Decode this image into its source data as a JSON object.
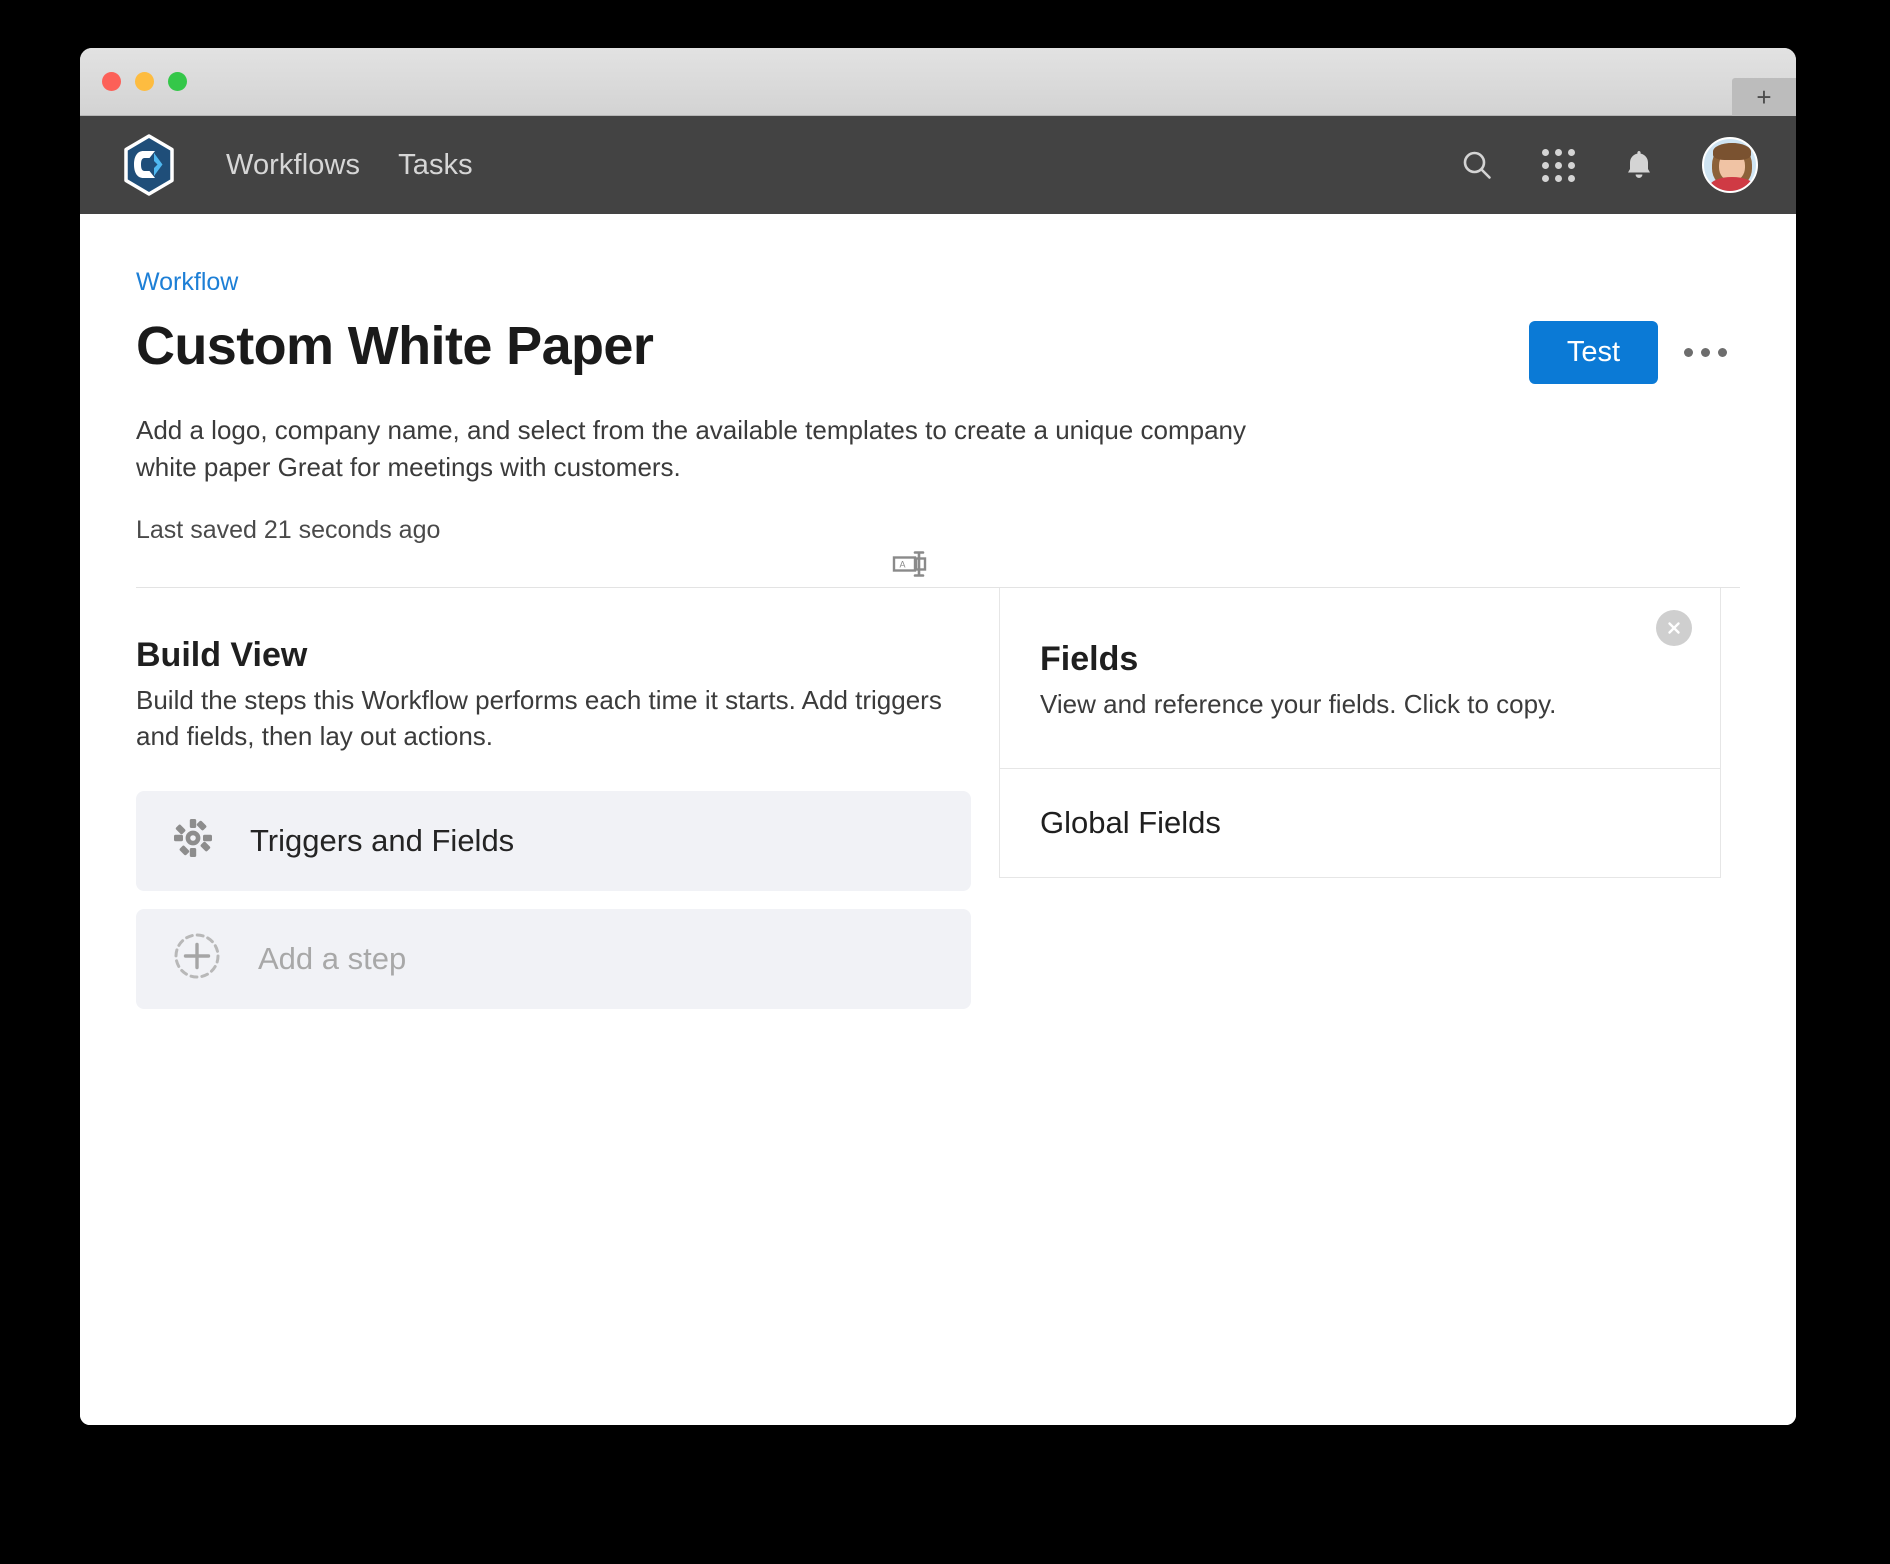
{
  "window": {
    "traffic_lights": [
      "close",
      "minimize",
      "zoom"
    ],
    "new_tab_label": "+"
  },
  "navbar": {
    "logo_name": "app-logo",
    "links": [
      {
        "label": "Workflows"
      },
      {
        "label": "Tasks"
      }
    ],
    "icons": [
      {
        "name": "search-icon"
      },
      {
        "name": "apps-grid-icon"
      },
      {
        "name": "notifications-bell-icon"
      }
    ],
    "avatar_alt": "User avatar"
  },
  "page": {
    "breadcrumb": "Workflow",
    "title": "Custom White Paper",
    "description": "Add a logo, company name, and select from the available templates to create a unique company white paper Great for meetings with customers.",
    "last_saved": "Last saved 21 seconds ago",
    "test_button": "Test",
    "more_menu_label": "More options"
  },
  "build_view": {
    "title": "Build View",
    "subtitle": "Build the steps this Workflow performs each time it starts. Add triggers and fields, then lay out actions.",
    "steps": [
      {
        "label": "Triggers and Fields",
        "icon": "gear-icon",
        "placeholder": false
      },
      {
        "label": "Add a step",
        "icon": "plus-circle-dashed-icon",
        "placeholder": true
      }
    ],
    "rename_icon": "rename-text-field-icon"
  },
  "fields_panel": {
    "title": "Fields",
    "subtitle": "View and reference your fields. Click to copy.",
    "close_label": "Close",
    "rows": [
      {
        "label": "Global Fields"
      }
    ]
  },
  "colors": {
    "accent_blue": "#0b7ad6",
    "link_blue": "#1d7fd6",
    "navbar_bg": "#434343",
    "card_bg": "#f1f2f6",
    "logo_dark": "#1f4e79",
    "logo_light": "#4fb8f0"
  }
}
